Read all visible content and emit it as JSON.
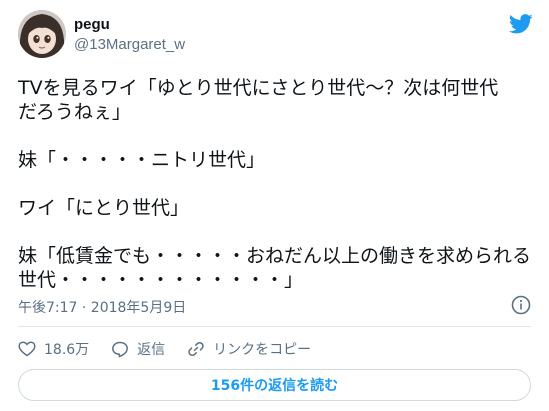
{
  "author": {
    "display_name": "pegu",
    "handle": "@13Margaret_w"
  },
  "tweet": {
    "lines": [
      "TVを見るワイ「ゆとり世代にさとり世代～？次は何世代",
      "だろうねぇ」",
      "",
      "妹「・・・・・ニトリ世代」",
      "",
      "ワイ「にとり世代」",
      "",
      "妹「低賃金でも・・・・・おねだん以上の働きを求められる",
      "世代・・・・・・・・・・・・」"
    ],
    "timestamp": "午後7:17 · 2018年5月9日"
  },
  "actions": {
    "like_count": "18.6万",
    "reply_label": "返信",
    "copy_link_label": "リンクをコピー"
  },
  "replies_button": "156件の返信を読む",
  "icons": [
    "avatar",
    "twitter-bird-icon",
    "info-icon",
    "heart-icon",
    "reply-icon",
    "link-icon"
  ],
  "colors": {
    "accent": "#1d9bf0",
    "secondary_text": "#5b7083",
    "divider": "#e1e8ed"
  }
}
